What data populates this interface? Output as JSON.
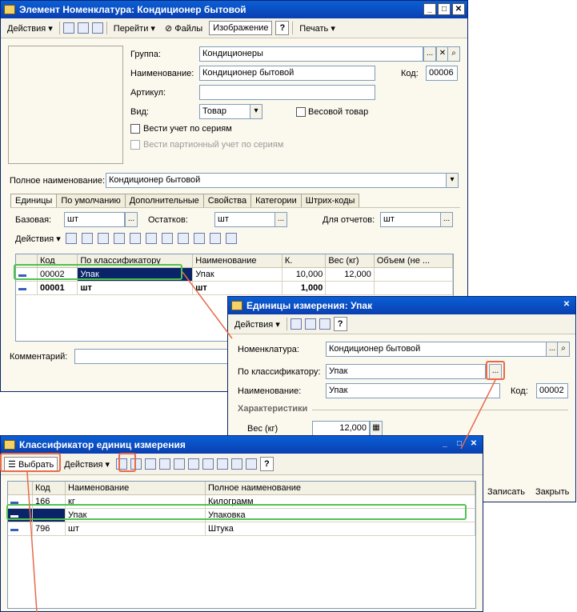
{
  "nom_window": {
    "title": "Элемент Номенклатура: Кондиционер бытовой",
    "toolbar": {
      "actions": "Действия",
      "goto": "Перейти",
      "files": "Файлы",
      "image": "Изображение",
      "help": "?",
      "print": "Печать"
    },
    "group_label": "Группа:",
    "group_value": "Кондиционеры",
    "name_label": "Наименование:",
    "name_value": "Кондиционер бытовой",
    "code_label": "Код:",
    "code_value": "00006",
    "article_label": "Артикул:",
    "article_value": "",
    "kind_label": "Вид:",
    "kind_value": "Товар",
    "weight_goods_label": "Весовой товар",
    "series_label": "Вести учет по сериям",
    "batch_label": "Вести партионный учет по сериям",
    "fullname_label": "Полное наименование:",
    "fullname_value": "Кондиционер бытовой",
    "tabs": [
      "Единицы",
      "По умолчанию",
      "Дополнительные",
      "Свойства",
      "Категории",
      "Штрих-коды"
    ],
    "base_label": "Базовая:",
    "base_value": "шт",
    "stock_label": "Остатков:",
    "stock_value": "шт",
    "report_label": "Для отчетов:",
    "report_value": "шт",
    "grid_actions": "Действия",
    "columns": [
      "Код",
      "По классификатору",
      "Наименование",
      "К.",
      "Вес (кг)",
      "Объем (не ..."
    ],
    "rows": [
      {
        "code": "00002",
        "classifier": "Упак",
        "name": "Упак",
        "k": "10,000",
        "weight": "12,000",
        "volume": ""
      },
      {
        "code": "00001",
        "classifier": "шт",
        "name": "шт",
        "k": "1,000",
        "weight": "",
        "volume": ""
      }
    ],
    "comment_label": "Комментарий:"
  },
  "unit_window": {
    "title": "Единицы измерения: Упак",
    "toolbar": {
      "actions": "Действия",
      "help": "?"
    },
    "nom_label": "Номенклатура:",
    "nom_value": "Кондиционер бытовой",
    "classifier_label": "По классификатору:",
    "classifier_value": "Упак",
    "name_label": "Наименование:",
    "name_value": "Упак",
    "code_label": "Код:",
    "code_value": "00002",
    "section": "Характеристики",
    "weight_label": "Вес (кг)",
    "weight_value": "12,000",
    "save": "Записать",
    "close": "Закрыть"
  },
  "classifier_window": {
    "title": "Классификатор единиц измерения",
    "select": "Выбрать",
    "actions": "Действия",
    "help": "?",
    "columns": [
      "Код",
      "Наименование",
      "Полное наименование"
    ],
    "rows": [
      {
        "code": "166",
        "name": "кг",
        "full": "Килограмм"
      },
      {
        "code": "",
        "name": "Упак",
        "full": "Упаковка"
      },
      {
        "code": "796",
        "name": "шт",
        "full": "Штука"
      }
    ]
  }
}
